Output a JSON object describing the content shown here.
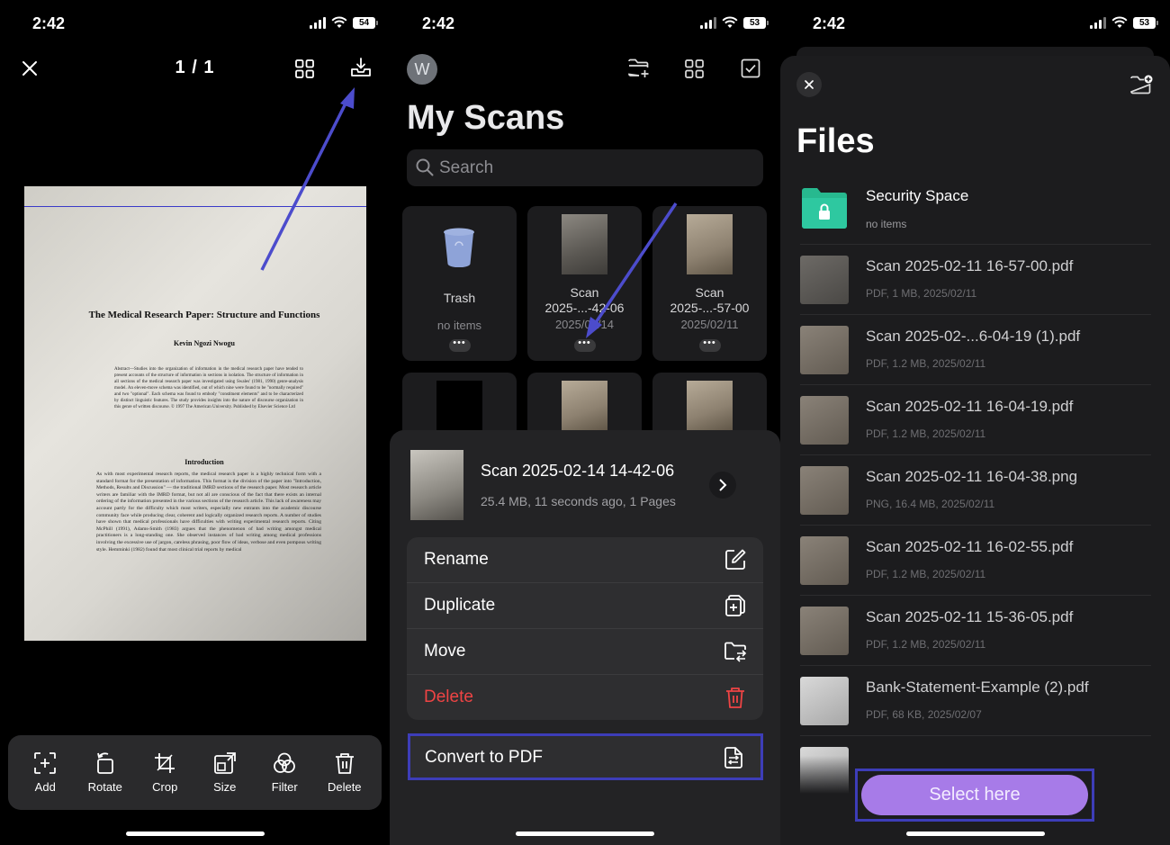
{
  "status_bars": [
    {
      "time": "2:42",
      "battery": "54"
    },
    {
      "time": "2:42",
      "battery": "53"
    },
    {
      "time": "2:42",
      "battery": "53"
    }
  ],
  "editor": {
    "page_indicator": "1 / 1",
    "document": {
      "title": "The Medical Research Paper: Structure and Functions",
      "author": "Kevin Ngozi Nwogu",
      "abstract": "Abstract—Studies into the organization of information in the medical research paper have tended to present accounts of the structure of information in sections in isolation. The structure of information in all sections of the medical research paper was investigated using Swales' (1981, 1990) genre-analysis model. An eleven-move schema was identified, out of which nine were found to be \"normally required\" and two \"optional\". Each schema was found to embody \"constituent elements\" and to be characterized by distinct linguistic features. The study provides insights into the nature of discourse organization in this genre of written discourse. © 1997 The American University. Published by Elsevier Science Ltd",
      "section_heading": "Introduction",
      "body": "As with most experimental research reports, the medical research paper is a highly technical form with a standard format for the presentation of information. This format is the division of the paper into \"Introduction, Methods, Results and Discussion\" — the traditional IMRD sections of the research paper. Most research article writers are familiar with the IMRD format, but not all are conscious of the fact that there exists an internal ordering of the information presented in the various sections of the research article. This lack of awareness may account partly for the difficulty which most writers, especially new entrants into the academic discourse community face while producing clear, coherent and logically organized research reports. A number of studies have shown that medical professionals have difficulties with writing experimental research reports. Citing McPhill (1991), Adams-Smith (1983) argues that the phenomenon of bad writing amongst medical practitioners is a long-standing one. She observed instances of bad writing among medical professions involving the excessive use of jargon, careless phrasing, poor flow of ideas, verbose and even pompous writing style. Hemminki (1982) found that most clinical trial reports by medical"
    },
    "toolbar": [
      {
        "label": "Add",
        "icon": "add-icon"
      },
      {
        "label": "Rotate",
        "icon": "rotate-icon"
      },
      {
        "label": "Crop",
        "icon": "crop-icon"
      },
      {
        "label": "Size",
        "icon": "size-icon"
      },
      {
        "label": "Filter",
        "icon": "filter-icon"
      },
      {
        "label": "Delete",
        "icon": "trash-icon"
      }
    ]
  },
  "scans": {
    "avatar_letter": "W",
    "title": "My Scans",
    "search_placeholder": "Search",
    "tiles": [
      {
        "name": "Trash",
        "meta": "no items"
      },
      {
        "name": "Scan\n2025-...-42-06",
        "meta": "2025/02/14"
      },
      {
        "name": "Scan\n2025-...-57-00",
        "meta": "2025/02/11"
      }
    ],
    "sheet": {
      "file_name": "Scan 2025-02-14 14-42-06",
      "file_meta": "25.4 MB, 11 seconds ago, 1 Pages",
      "menu": [
        {
          "label": "Rename",
          "icon": "edit-icon"
        },
        {
          "label": "Duplicate",
          "icon": "duplicate-icon"
        },
        {
          "label": "Move",
          "icon": "move-folder-icon"
        },
        {
          "label": "Delete",
          "icon": "trash-icon",
          "danger": true
        }
      ],
      "convert_label": "Convert to PDF"
    }
  },
  "files": {
    "title": "Files",
    "security": {
      "name": "Security Space",
      "meta": "no items"
    },
    "items": [
      {
        "name": "Scan 2025-02-11 16-57-00.pdf",
        "meta": "PDF, 1 MB, 2025/02/11"
      },
      {
        "name": "Scan 2025-02-...6-04-19 (1).pdf",
        "meta": "PDF, 1.2 MB, 2025/02/11"
      },
      {
        "name": "Scan 2025-02-11 16-04-19.pdf",
        "meta": "PDF, 1.2 MB, 2025/02/11"
      },
      {
        "name": "Scan 2025-02-11 16-04-38.png",
        "meta": "PNG, 16.4 MB, 2025/02/11"
      },
      {
        "name": "Scan 2025-02-11 16-02-55.pdf",
        "meta": "PDF, 1.2 MB, 2025/02/11"
      },
      {
        "name": "Scan 2025-02-11 15-36-05.pdf",
        "meta": "PDF, 1.2 MB, 2025/02/11"
      },
      {
        "name": "Bank-Statement-Example (2).pdf",
        "meta": "PDF, 68 KB, 2025/02/07"
      }
    ],
    "select_label": "Select here"
  },
  "colors": {
    "accent_purple": "#a77be8",
    "highlight_border": "#3d3db8",
    "danger": "#ef4444",
    "folder_green": "#2ec8a0"
  }
}
